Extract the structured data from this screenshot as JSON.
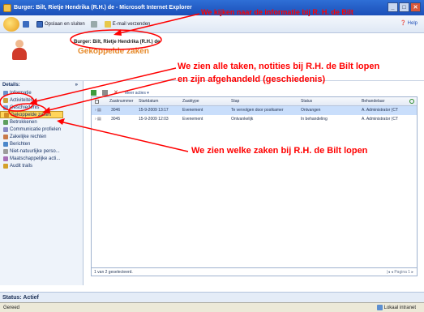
{
  "window": {
    "title": "Burger: Bilt, Rietje Hendrika (R.H.) de - Microsoft Internet Explorer"
  },
  "commandbar": {
    "items": [
      {
        "label": "",
        "icon": "save-icon"
      },
      {
        "label": "Opslaan en sluiten",
        "icon": "save-close-icon"
      },
      {
        "label": "",
        "icon": "printer-icon"
      },
      {
        "label": "E-mail verzenden",
        "icon": "mail-icon"
      }
    ],
    "help": "Help"
  },
  "record": {
    "title": "Burger: Bilt, Rietje Hendrika (R.H.) de",
    "subtitle": "Gekoppelde zaken"
  },
  "nav": {
    "header": "Details:",
    "collapse": "»",
    "items": [
      {
        "label": "Informatie"
      },
      {
        "label": "Activiteiten"
      },
      {
        "label": "Geschiedenis"
      },
      {
        "label": "Gekoppelde zaken",
        "selected": true
      },
      {
        "label": "Betrokkenen"
      },
      {
        "label": "Communicatie profielen"
      },
      {
        "label": "Zakelijke rechten"
      },
      {
        "label": "Berichten"
      },
      {
        "label": "Niet-natuurlijke perso..."
      },
      {
        "label": "Maatschappelijke acti..."
      },
      {
        "label": "Audit trails"
      }
    ]
  },
  "grid": {
    "toolbar": {
      "more": "Meer acties"
    },
    "columns": [
      "Zaaknummer",
      "Startdatum",
      "Zaaktype",
      "Stap",
      "Status",
      "Behandelaar"
    ],
    "rows": [
      [
        "3046",
        "15-9-2009 13:17",
        "Evenement",
        "Te vervolgen door postkamer",
        "Ontvangen",
        "A. Administrator (CT"
      ],
      [
        "3045",
        "15-9-2009 12:03",
        "Evenement",
        "Ontvankelijk",
        "In behandeling",
        "A. Administrator (CT"
      ]
    ],
    "footer": "1 van 2 geselecteerd.",
    "pager": "Pagina 1"
  },
  "status": {
    "label": "Status: Actief"
  },
  "ie": {
    "left": "Gereed",
    "zone": "Lokaal intranet"
  },
  "annotations": {
    "note1": "We kijken naar de informatie bij R. H. de Bilt",
    "note2a": "We zien alle taken, notities bij R.H. de Bilt lopen",
    "note2b": "en zijn afgehandeld (geschiedenis)",
    "note3": "We zien welke zaken bij R.H. de Bilt lopen"
  },
  "colors": {
    "annotation": "#ff0000",
    "accent": "#e68a2a",
    "selection": "#ffd55b"
  }
}
